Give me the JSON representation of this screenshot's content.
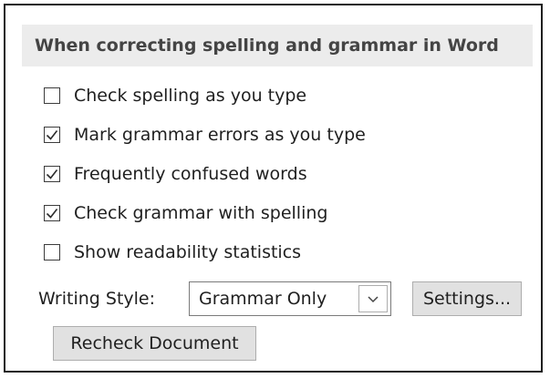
{
  "section": {
    "title": "When correcting spelling and grammar in Word"
  },
  "options": [
    {
      "label": "Check spelling as you type",
      "checked": false
    },
    {
      "label": "Mark grammar errors as you type",
      "checked": true
    },
    {
      "label": "Frequently confused words",
      "checked": true
    },
    {
      "label": "Check grammar with spelling",
      "checked": true
    },
    {
      "label": "Show readability statistics",
      "checked": false
    }
  ],
  "writing_style": {
    "label": "Writing Style:",
    "selected": "Grammar Only",
    "dropdown_icon": "chevron-down-icon"
  },
  "buttons": {
    "settings": "Settings...",
    "recheck": "Recheck Document"
  },
  "colors": {
    "header_background": "#ececec",
    "header_text": "#444444",
    "button_background": "#e1e1e1",
    "border": "#1f1f1f"
  },
  "icons": {
    "check": "check-icon",
    "dropdown": "chevron-down-icon"
  }
}
